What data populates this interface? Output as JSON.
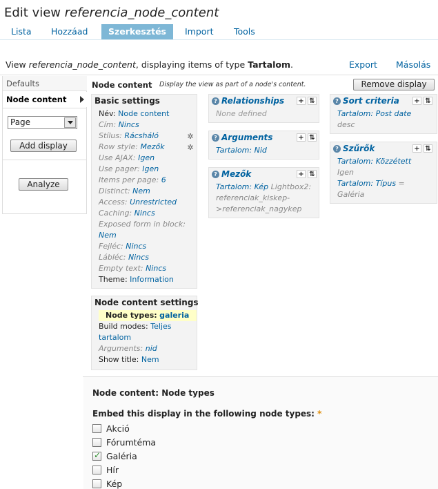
{
  "header": {
    "title_prefix": "Edit view ",
    "title_view": "referencia_node_content"
  },
  "tabs": [
    {
      "label": "Lista"
    },
    {
      "label": "Hozzáad"
    },
    {
      "label": "Szerkesztés"
    },
    {
      "label": "Import"
    },
    {
      "label": "Tools"
    }
  ],
  "view_desc": {
    "prefix": "View ",
    "view_name": "referencia_node_content",
    "middle": ", displaying items of type ",
    "type": "Tartalom",
    "suffix": "."
  },
  "links": {
    "export": "Export",
    "masolas": "Másolás"
  },
  "displays": {
    "defaults": "Defaults",
    "node_content": "Node content",
    "select_value": "Page",
    "add_display": "Add display",
    "analyze": "Analyze"
  },
  "node_content": {
    "title": "Node content",
    "description": "Display the view as part of a node's content.",
    "remove_button": "Remove display"
  },
  "basic_settings": {
    "title": "Basic settings",
    "rows": [
      {
        "label": "Név:",
        "value": "Node content",
        "override": false
      },
      {
        "label": "Cím:",
        "value": "Nincs",
        "override": true
      },
      {
        "label": "Stílus:",
        "value": "Rácsháló",
        "override": true
      },
      {
        "label": "Row style:",
        "value": "Mezők",
        "override": true
      },
      {
        "label": "Use AJAX:",
        "value": "Igen",
        "override": true
      },
      {
        "label": "Use pager:",
        "value": "Igen",
        "override": true
      },
      {
        "label": "Items per page:",
        "value": "6",
        "override": true
      },
      {
        "label": "Distinct:",
        "value": "Nem",
        "override": true
      },
      {
        "label": "Access:",
        "value": "Unrestricted",
        "override": true
      },
      {
        "label": "Caching:",
        "value": "Nincs",
        "override": true
      },
      {
        "label": "Exposed form in block:",
        "value": "",
        "override": true
      },
      {
        "label": "",
        "value": "Nem",
        "override": true
      },
      {
        "label": "Fejléc:",
        "value": "Nincs",
        "override": true
      },
      {
        "label": "Lábléc:",
        "value": "Nincs",
        "override": true
      },
      {
        "label": "Empty text:",
        "value": "Nincs",
        "override": true
      },
      {
        "label": "Theme:",
        "value": "Information",
        "override": false
      }
    ]
  },
  "nc_settings": {
    "title": "Node content settings",
    "node_types_label": "Node types:",
    "node_types_value": "galeria",
    "build_modes_label": "Build modes:",
    "build_modes_value1": "Teljes",
    "build_modes_value2": "tartalom",
    "arguments_label": "Arguments:",
    "arguments_value": "nid",
    "show_title_label": "Show title:",
    "show_title_value": "Nem"
  },
  "relationships": {
    "title": "Relationships",
    "empty": "None defined"
  },
  "arguments": {
    "title": "Arguments",
    "item": "Tartalom: Nid"
  },
  "fields": {
    "title": "Mezők",
    "item_link": "Tartalom: Kép",
    "item_rest1": " Lightbox2:",
    "item_rest2": "referenciak_kiskep-",
    "item_rest3": ">referenciak_nagykep"
  },
  "sort": {
    "title": "Sort criteria",
    "item": "Tartalom: Post date",
    "item_sub": "desc"
  },
  "filters": {
    "title": "Szűrők",
    "item1": "Tartalom: Közzétett",
    "item1_sub": "Igen",
    "item2": "Tartalom: Típus",
    "item2_rest": " =",
    "item2_sub": "Galéria"
  },
  "node_types_form": {
    "title": "Node content: Node types",
    "embed_label": "Embed this display in the following node types:",
    "required_mark": "*",
    "options": [
      {
        "label": "Akció",
        "checked": false
      },
      {
        "label": "Fórumtéma",
        "checked": false
      },
      {
        "label": "Galéria",
        "checked": true
      },
      {
        "label": "Hír",
        "checked": false
      },
      {
        "label": "Kép",
        "checked": false
      }
    ]
  },
  "icons": {
    "gear": "gear-icon",
    "help": "help-icon",
    "add": "add-icon",
    "rearrange": "rearrange-icon"
  },
  "colors": {
    "link": "#0062a0",
    "active_tab": "#7eb7d6",
    "panel_bg": "#f3f3f3",
    "check": "#2a8a2a",
    "required": "#e09010"
  }
}
